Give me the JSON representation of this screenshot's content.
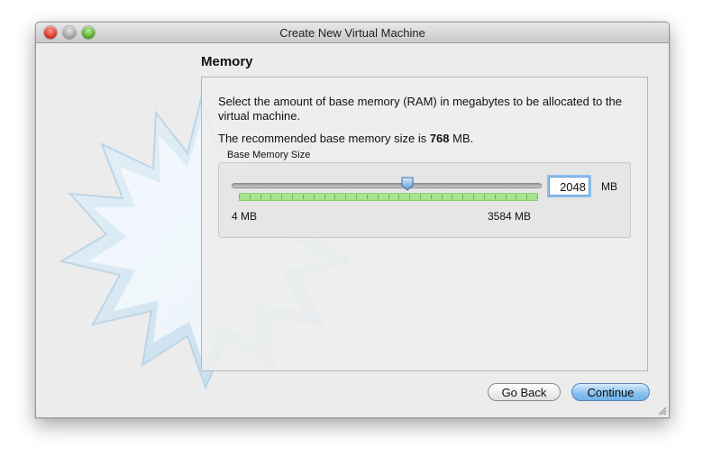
{
  "window": {
    "title": "Create New Virtual Machine"
  },
  "page": {
    "section_title": "Memory",
    "description": "Select the amount of base memory (RAM) in megabytes to be allocated to the virtual machine.",
    "recommend_prefix": "The recommended base memory size is ",
    "recommend_value": "768",
    "recommend_suffix": " MB."
  },
  "memory": {
    "group_label": "Base Memory Size",
    "min_label": "4 MB",
    "max_label": "3584 MB",
    "value": "2048",
    "unit": "MB",
    "min": 4,
    "max": 3584,
    "slider_fraction": 0.57
  },
  "buttons": {
    "back_label": "Go Back",
    "continue_label": "Continue"
  },
  "colors": {
    "accent": "#6fb0ea",
    "tick_fill": "#a6e48f"
  }
}
